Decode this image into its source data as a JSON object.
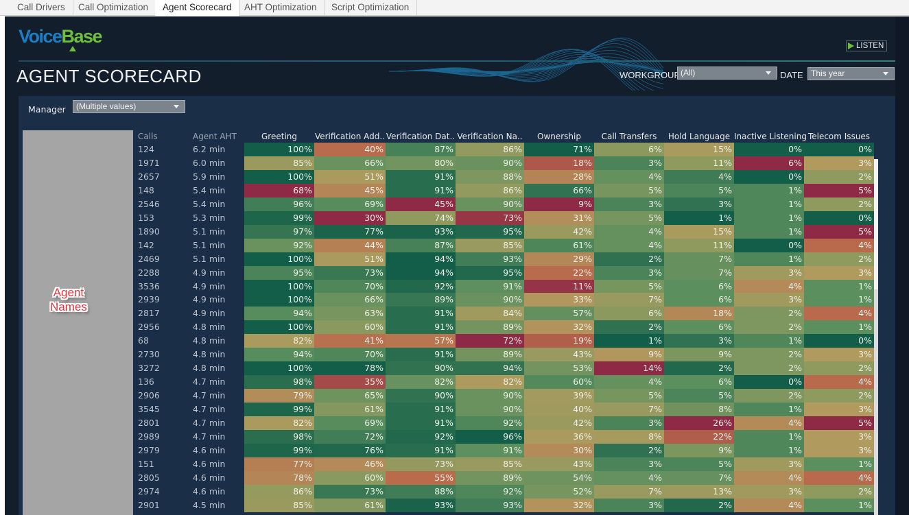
{
  "tabs": [
    {
      "label": "Call Drivers",
      "active": false
    },
    {
      "label": "Call Optimization",
      "active": false
    },
    {
      "label": "Agent Scorecard",
      "active": true
    },
    {
      "label": "AHT Optimization",
      "active": false
    },
    {
      "label": "Script Optimization",
      "active": false
    }
  ],
  "brand": {
    "voice": "Voice",
    "base": "Base"
  },
  "header": {
    "title": "AGENT SCORECARD",
    "listen_label": "LISTEN",
    "workgroup_label": "WORKGROUP",
    "workgroup_value": "(All)",
    "date_label": "DATE",
    "date_value": "This year"
  },
  "filters": {
    "manager_label": "Manager",
    "manager_value": "(Multiple values)"
  },
  "names_overlay": {
    "line1": "Agent",
    "line2": "Names"
  },
  "colors": {
    "red": "#8e2a45",
    "orange": "#b96a4c",
    "tan": "#b09a5e",
    "olive": "#8f9a5f",
    "green": "#5c8f5e",
    "dark_green": "#135e48"
  },
  "table": {
    "columns": [
      "Calls",
      "Agent AHT",
      "Greeting",
      "Verification Add..",
      "Verification Dat..",
      "Verification Na..",
      "Ownership",
      "Call Transfers",
      "Hold Language",
      "Inactive Listening",
      "Telecom Issues"
    ],
    "rows": [
      {
        "calls": "124",
        "aht": "6.2 min",
        "scores": [
          100,
          40,
          87,
          86,
          71,
          6,
          15,
          0,
          0
        ]
      },
      {
        "calls": "1971",
        "aht": "6.0 min",
        "scores": [
          85,
          66,
          80,
          90,
          18,
          3,
          11,
          6,
          3
        ]
      },
      {
        "calls": "2657",
        "aht": "5.9 min",
        "scores": [
          100,
          51,
          91,
          88,
          28,
          4,
          4,
          0,
          2
        ]
      },
      {
        "calls": "148",
        "aht": "5.4 min",
        "scores": [
          68,
          45,
          91,
          86,
          66,
          5,
          5,
          1,
          5
        ]
      },
      {
        "calls": "2546",
        "aht": "5.4 min",
        "scores": [
          96,
          69,
          45,
          90,
          9,
          3,
          3,
          1,
          2
        ]
      },
      {
        "calls": "153",
        "aht": "5.3 min",
        "scores": [
          99,
          30,
          74,
          73,
          31,
          5,
          1,
          1,
          0
        ]
      },
      {
        "calls": "1890",
        "aht": "5.1 min",
        "scores": [
          97,
          77,
          93,
          95,
          42,
          4,
          15,
          1,
          5
        ]
      },
      {
        "calls": "142",
        "aht": "5.1 min",
        "scores": [
          92,
          44,
          87,
          85,
          61,
          4,
          11,
          0,
          4
        ]
      },
      {
        "calls": "2469",
        "aht": "5.1 min",
        "scores": [
          100,
          51,
          94,
          93,
          29,
          2,
          7,
          1,
          2
        ]
      },
      {
        "calls": "2288",
        "aht": "4.9 min",
        "scores": [
          95,
          73,
          94,
          95,
          22,
          3,
          7,
          3,
          3
        ]
      },
      {
        "calls": "3536",
        "aht": "4.9 min",
        "scores": [
          100,
          70,
          92,
          91,
          11,
          5,
          6,
          4,
          1
        ]
      },
      {
        "calls": "2939",
        "aht": "4.9 min",
        "scores": [
          100,
          66,
          89,
          90,
          33,
          7,
          6,
          3,
          1
        ]
      },
      {
        "calls": "2817",
        "aht": "4.9 min",
        "scores": [
          94,
          63,
          91,
          84,
          57,
          6,
          18,
          2,
          4
        ]
      },
      {
        "calls": "2956",
        "aht": "4.8 min",
        "scores": [
          100,
          60,
          91,
          89,
          32,
          2,
          6,
          2,
          1
        ]
      },
      {
        "calls": "68",
        "aht": "4.8 min",
        "scores": [
          82,
          41,
          57,
          72,
          19,
          1,
          3,
          1,
          0
        ]
      },
      {
        "calls": "2730",
        "aht": "4.8 min",
        "scores": [
          94,
          70,
          91,
          89,
          43,
          9,
          9,
          2,
          3
        ]
      },
      {
        "calls": "3272",
        "aht": "4.8 min",
        "scores": [
          100,
          78,
          90,
          94,
          53,
          14,
          2,
          2,
          2
        ]
      },
      {
        "calls": "136",
        "aht": "4.7 min",
        "scores": [
          98,
          35,
          82,
          82,
          60,
          4,
          6,
          0,
          4
        ]
      },
      {
        "calls": "2906",
        "aht": "4.7 min",
        "scores": [
          79,
          65,
          90,
          90,
          39,
          5,
          5,
          2,
          2
        ]
      },
      {
        "calls": "3545",
        "aht": "4.7 min",
        "scores": [
          99,
          61,
          91,
          90,
          40,
          7,
          8,
          1,
          3
        ]
      },
      {
        "calls": "2801",
        "aht": "4.7 min",
        "scores": [
          82,
          69,
          91,
          92,
          42,
          3,
          26,
          4,
          5
        ]
      },
      {
        "calls": "2989",
        "aht": "4.7 min",
        "scores": [
          98,
          72,
          92,
          96,
          36,
          8,
          22,
          1,
          3
        ]
      },
      {
        "calls": "2979",
        "aht": "4.6 min",
        "scores": [
          99,
          76,
          91,
          91,
          30,
          2,
          9,
          1,
          3
        ]
      },
      {
        "calls": "151",
        "aht": "4.6 min",
        "scores": [
          77,
          46,
          73,
          85,
          43,
          3,
          5,
          3,
          1
        ]
      },
      {
        "calls": "2805",
        "aht": "4.6 min",
        "scores": [
          78,
          60,
          55,
          89,
          54,
          4,
          7,
          4,
          4
        ]
      },
      {
        "calls": "2974",
        "aht": "4.6 min",
        "scores": [
          86,
          73,
          88,
          92,
          52,
          7,
          13,
          3,
          2
        ]
      },
      {
        "calls": "2901",
        "aht": "4.5 min",
        "scores": [
          85,
          61,
          93,
          93,
          32,
          3,
          2,
          4,
          1
        ]
      }
    ],
    "score_direction": [
      "higher_better",
      "higher_better",
      "higher_better",
      "higher_better",
      "higher_better",
      "lower_better",
      "lower_better",
      "lower_better",
      "lower_better"
    ]
  }
}
